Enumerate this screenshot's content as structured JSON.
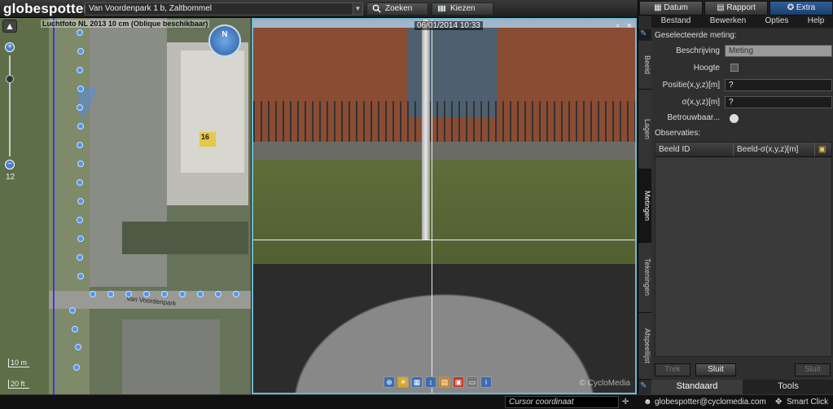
{
  "app": {
    "logo": "globespotter"
  },
  "toolbar": {
    "address": "Van Voordenpark  1 b, Zaltbommel",
    "search_label": "Zoeken",
    "choose_label": "Kiezen"
  },
  "map": {
    "caption": "Luchtfoto NL 2013 10 cm (Oblique beschikbaar)",
    "zoom_level": "12",
    "zoom_in": "+",
    "zoom_out": "−",
    "compass_label": "N",
    "scale_top": "10 m",
    "scale_bottom": "20 ft",
    "street_label": "Van Voordenpark",
    "building_number": "16"
  },
  "panorama": {
    "date": "06/01/2014 10:33",
    "restore": "▫",
    "close": "×",
    "watermark": "© CycloMedia",
    "tools": [
      "zoom-icon",
      "sun-icon",
      "grid-icon",
      "info-height-icon",
      "book-icon",
      "calendar-icon",
      "print-icon",
      "info-icon"
    ]
  },
  "right_panel": {
    "top_buttons": [
      "Datum",
      "Rapport",
      "Extra"
    ],
    "menu": [
      "Bestand",
      "Bewerken",
      "Opties",
      "Help"
    ],
    "vtabs": [
      "Beeld",
      "Lagen",
      "Metingen",
      "Tekeningen",
      "Afspeellijst"
    ],
    "section_title": "Geselecteerde meting:",
    "fields": {
      "beschrijving_label": "Beschrijving",
      "beschrijving_value": "Meting",
      "hoogte_label": "Hoogte",
      "positie_label": "Positie(x,y,z)[m]",
      "positie_value": "?",
      "sigma_label": "σ(x,y,z)[m]",
      "sigma_value": "?",
      "betrouw_label": "Betrouwbaar..."
    },
    "observaties_label": "Observaties:",
    "table_headers": [
      "Beeld ID",
      "Beeld-σ(x,y,z)[m]"
    ],
    "buttons": {
      "left": "Trek",
      "close": "Sluit",
      "right": "Sluit"
    },
    "bottom_tabs": [
      "Standaard",
      "Tools"
    ]
  },
  "status": {
    "cursor_placeholder": "Cursor coordinaat",
    "user": "globespotter@cyclomedia.com",
    "smart_click": "Smart Click"
  }
}
